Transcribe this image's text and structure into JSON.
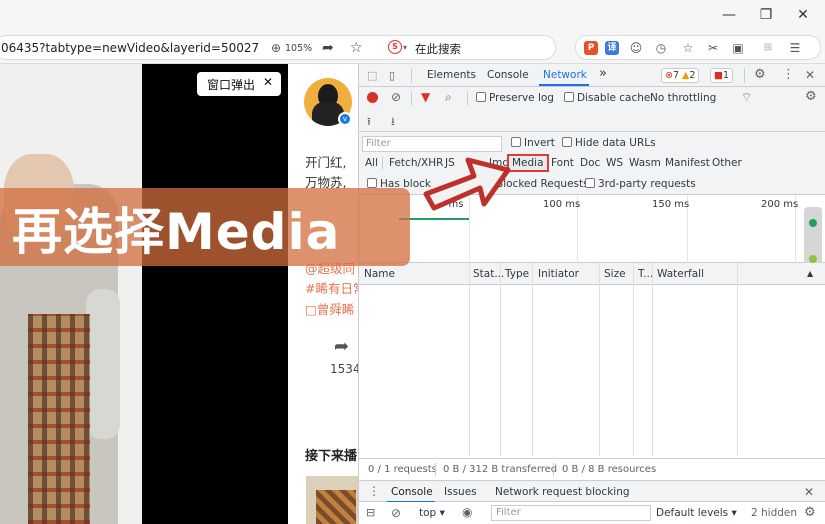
{
  "window": {
    "minimize_glyph": "—",
    "restore_glyph": "❐",
    "close_glyph": "✕"
  },
  "address_bar": {
    "url": "06435?tabtype=newVideo&layerid=50027",
    "zoom": "105%",
    "search_placeholder": "在此搜索"
  },
  "video": {
    "popout_label": "窗口弹出",
    "popout_close": "✕"
  },
  "post": {
    "line1": "开门红,",
    "line2": "万物苏,",
    "line3": "@超级同",
    "line4": "#睎有日常",
    "line5": "□曾舜睎",
    "share_count": "1534",
    "next_label": "接下来播"
  },
  "overlay": {
    "caption": "再选择Media"
  },
  "devtools": {
    "tabs": [
      "Elements",
      "Console",
      "Network"
    ],
    "more_tabs": "»",
    "errors": "7",
    "warnings": "2",
    "issues": "1",
    "toolbar": {
      "preserve_log": "Preserve log",
      "disable_cache": "Disable cache",
      "throttling": "No throttling"
    },
    "filter": {
      "placeholder": "Filter",
      "invert": "Invert",
      "hide_data_urls": "Hide data URLs",
      "types": [
        "All",
        "Fetch/XHR",
        "JS",
        "Img",
        "Media",
        "Font",
        "Doc",
        "WS",
        "Wasm",
        "Manifest",
        "Other"
      ],
      "has_blocked_cookies": "Has block",
      "blocked_requests": "Blocked Requests",
      "third_party": "3rd-party requests"
    },
    "timeline_ticks": [
      "0 ms",
      "100 ms",
      "150 ms",
      "200 ms"
    ],
    "columns": [
      "Name",
      "Stat...",
      "Type",
      "Initiator",
      "Size",
      "T...",
      "Waterfall"
    ],
    "status": {
      "requests": "0 / 1 requests",
      "transferred": "0 B / 312 B transferred",
      "resources": "0 B / 8 B resources"
    },
    "drawer": {
      "tabs": [
        "Console",
        "Issues",
        "Network request blocking"
      ],
      "context": "top",
      "filter_placeholder": "Filter",
      "levels": "Default levels",
      "hidden": "2 hidden"
    }
  }
}
